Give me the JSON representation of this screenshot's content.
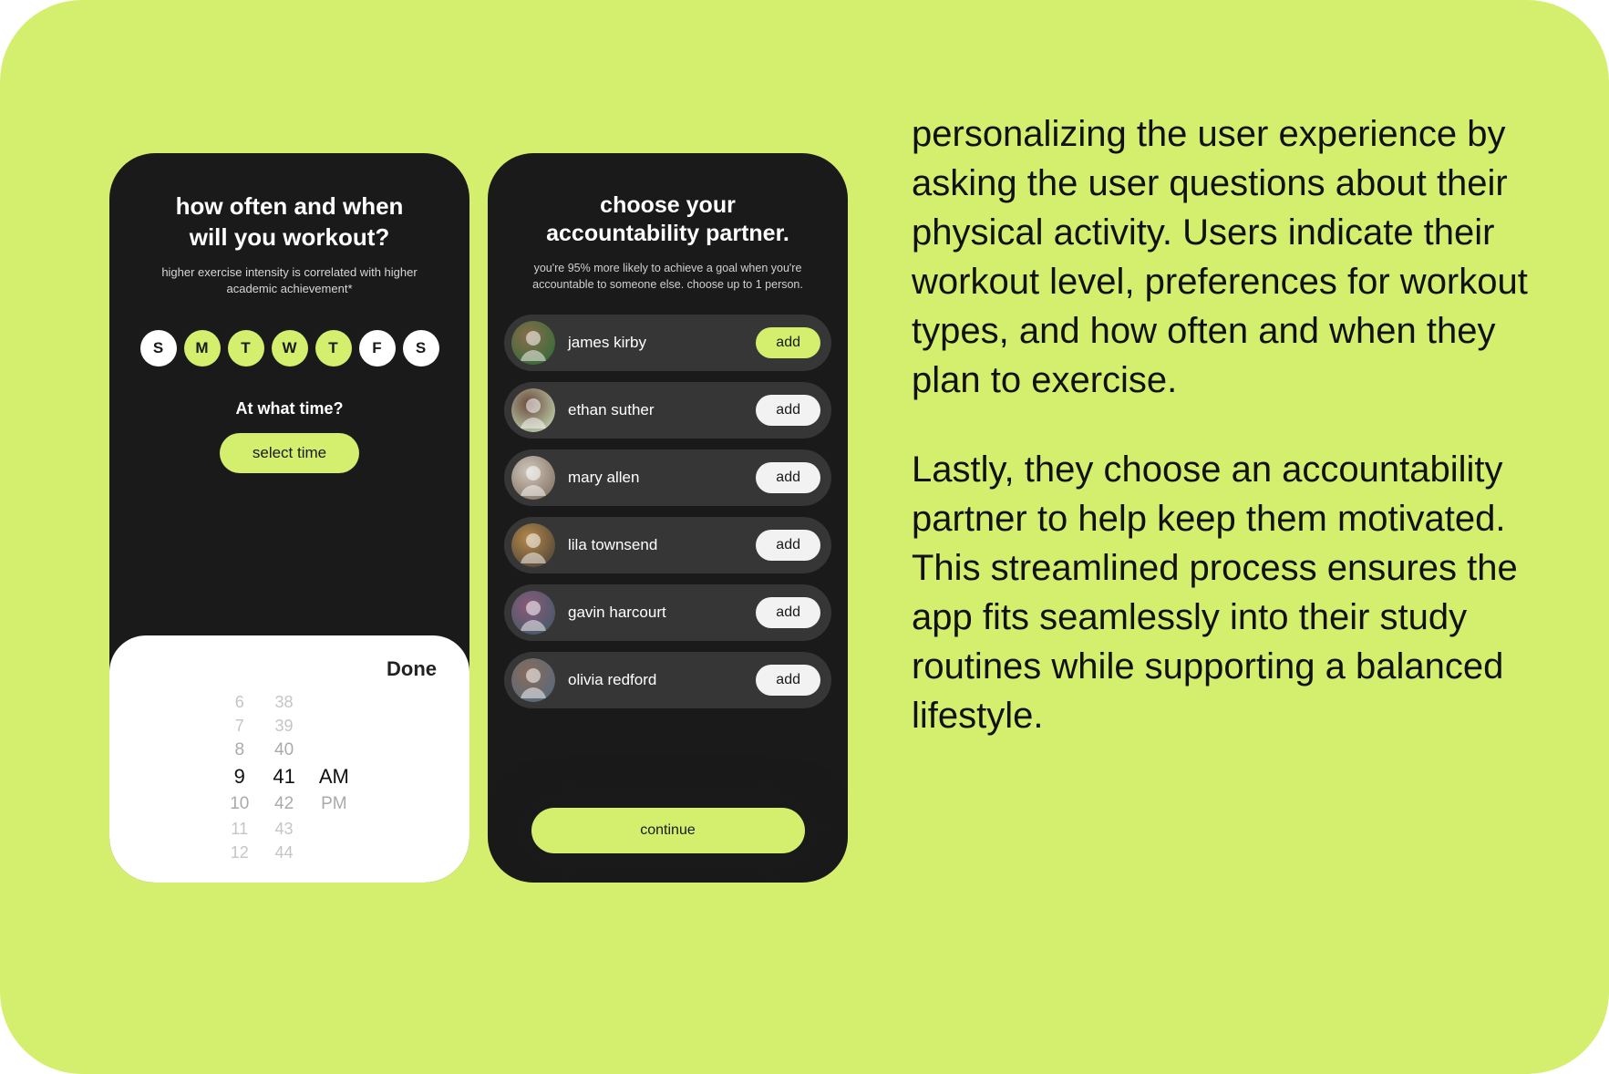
{
  "phone1": {
    "title_line1": "how often and when",
    "title_line2": "will you workout?",
    "subtext": "higher exercise intensity is correlated with higher academic achievement*",
    "days": [
      {
        "label": "S",
        "selected": false
      },
      {
        "label": "M",
        "selected": true
      },
      {
        "label": "T",
        "selected": true
      },
      {
        "label": "W",
        "selected": true
      },
      {
        "label": "T",
        "selected": true
      },
      {
        "label": "F",
        "selected": false
      },
      {
        "label": "S",
        "selected": false
      }
    ],
    "time_question": "At what time?",
    "select_time_label": "select time",
    "picker": {
      "done_label": "Done",
      "hours": [
        "6",
        "7",
        "8",
        "9",
        "10",
        "11",
        "12"
      ],
      "minutes": [
        "38",
        "39",
        "40",
        "41",
        "42",
        "43",
        "44"
      ],
      "ampm": [
        "",
        "",
        "",
        "AM",
        "PM",
        "",
        ""
      ],
      "selected_index": 3
    }
  },
  "phone2": {
    "title_line1": "choose your",
    "title_line2": "accountability partner.",
    "subtext": "you're 95% more likely to achieve a goal when you're accountable to someone else. choose up to 1 person.",
    "add_label": "add",
    "continue_label": "continue",
    "partners": [
      {
        "name": "james kirby",
        "selected": true,
        "avatar_colors": [
          "#8a6d4a",
          "#3b6b3b"
        ]
      },
      {
        "name": "ethan suther",
        "selected": false,
        "avatar_colors": [
          "#6b4a3c",
          "#b9c7a6"
        ]
      },
      {
        "name": "mary allen",
        "selected": false,
        "avatar_colors": [
          "#cfc7bd",
          "#8a7a6a"
        ]
      },
      {
        "name": "lila townsend",
        "selected": false,
        "avatar_colors": [
          "#b48a4a",
          "#5a4a3a"
        ]
      },
      {
        "name": "gavin harcourt",
        "selected": false,
        "avatar_colors": [
          "#8a5a7a",
          "#4a5a6a"
        ]
      },
      {
        "name": "olivia redford",
        "selected": false,
        "avatar_colors": [
          "#8a6a5a",
          "#5a6a7a"
        ]
      }
    ]
  },
  "copy": {
    "p1": "personalizing the user experience by asking the user questions about their physical activity. Users indicate their workout level, preferences for workout types, and how often and when they plan to exercise.",
    "p2": "Lastly, they choose an accountability partner to help keep them motivated. This streamlined process ensures the app fits seamlessly into their study routines while supporting a balanced lifestyle."
  }
}
